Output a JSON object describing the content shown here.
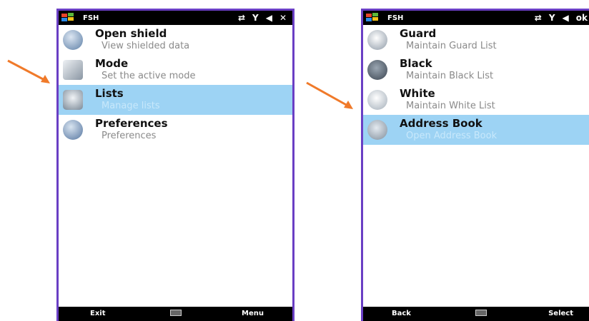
{
  "colors": {
    "frame": "#6a3fc4",
    "selection": "#9dd3f4",
    "arrow": "#f07a2a",
    "bar": "#000000"
  },
  "left_screen": {
    "app_name": "FSH",
    "status_icons": [
      "transfer-icon",
      "signal-icon",
      "volume-icon",
      "close-icon"
    ],
    "close_glyph": "✕",
    "items": [
      {
        "title": "Open shield",
        "subtitle": "View shielded data",
        "icon": "shield-icon"
      },
      {
        "title": "Mode",
        "subtitle": "Set the active mode",
        "icon": "mode-icon"
      },
      {
        "title": "Lists",
        "subtitle": "Manage lists",
        "icon": "lists-icon"
      },
      {
        "title": "Preferences",
        "subtitle": "Preferences",
        "icon": "preferences-icon"
      }
    ],
    "selected_index": 2,
    "softkeys": {
      "left": "Exit",
      "right": "Menu"
    }
  },
  "right_screen": {
    "app_name": "FSH",
    "status_icons": [
      "transfer-icon",
      "signal-icon",
      "volume-icon",
      "ok-icon"
    ],
    "ok_glyph": "ok",
    "items": [
      {
        "title": "Guard",
        "subtitle": "Maintain Guard List",
        "icon": "guard-icon"
      },
      {
        "title": "Black",
        "subtitle": "Maintain Black List",
        "icon": "black-list-icon"
      },
      {
        "title": "White",
        "subtitle": "Maintain White List",
        "icon": "white-list-icon"
      },
      {
        "title": "Address Book",
        "subtitle": "Open Address Book",
        "icon": "address-book-icon"
      }
    ],
    "selected_index": 3,
    "softkeys": {
      "left": "Back",
      "right": "Select"
    }
  }
}
